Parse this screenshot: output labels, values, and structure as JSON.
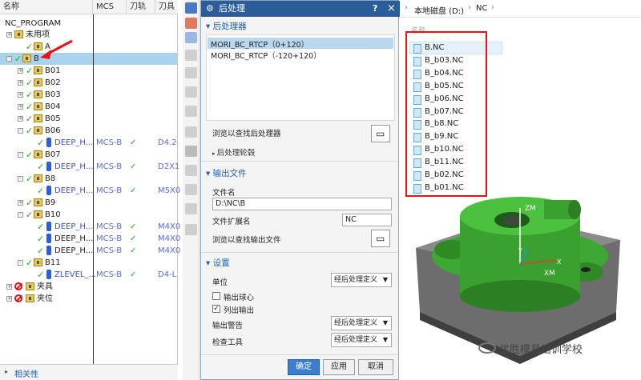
{
  "navigator": {
    "columns": [
      "名称",
      "MCS",
      "刀轨",
      "刀具"
    ],
    "root": "NC_PROGRAM",
    "rows": [
      {
        "indent": 0,
        "exp": "+",
        "icon": "none",
        "label": "未用项",
        "mcs": "",
        "path": "",
        "tool": ""
      },
      {
        "indent": 1,
        "exp": "",
        "icon": "group",
        "label": "A",
        "mcs": "",
        "path": "",
        "tool": ""
      },
      {
        "indent": 0,
        "exp": "-",
        "icon": "group",
        "label": "B",
        "mcs": "",
        "path": "",
        "tool": "",
        "selected": true
      },
      {
        "indent": 1,
        "exp": "+",
        "icon": "group",
        "label": "B01",
        "mcs": "",
        "path": "",
        "tool": ""
      },
      {
        "indent": 1,
        "exp": "+",
        "icon": "group",
        "label": "B02",
        "mcs": "",
        "path": "",
        "tool": ""
      },
      {
        "indent": 1,
        "exp": "+",
        "icon": "group",
        "label": "B03",
        "mcs": "",
        "path": "",
        "tool": ""
      },
      {
        "indent": 1,
        "exp": "+",
        "icon": "group",
        "label": "B04",
        "mcs": "",
        "path": "",
        "tool": ""
      },
      {
        "indent": 1,
        "exp": "+",
        "icon": "group",
        "label": "B05",
        "mcs": "",
        "path": "",
        "tool": ""
      },
      {
        "indent": 1,
        "exp": "-",
        "icon": "group",
        "label": "B06",
        "mcs": "",
        "path": "",
        "tool": ""
      },
      {
        "indent": 2,
        "exp": "",
        "icon": "op",
        "label": "DEEP_H...",
        "mcs": "MCS-B",
        "path": "✓",
        "tool": "D4.2",
        "op": true
      },
      {
        "indent": 1,
        "exp": "-",
        "icon": "group",
        "label": "B07",
        "mcs": "",
        "path": "",
        "tool": ""
      },
      {
        "indent": 2,
        "exp": "",
        "icon": "op",
        "label": "DEEP_H...",
        "mcs": "MCS-B",
        "path": "✓",
        "tool": "D2X1",
        "op": true
      },
      {
        "indent": 1,
        "exp": "-",
        "icon": "group",
        "label": "B8",
        "mcs": "",
        "path": "",
        "tool": ""
      },
      {
        "indent": 2,
        "exp": "",
        "icon": "op",
        "label": "DEEP_H...",
        "mcs": "MCS-B",
        "path": "✓",
        "tool": "M5X0",
        "op": true
      },
      {
        "indent": 1,
        "exp": "+",
        "icon": "group",
        "label": "B9",
        "mcs": "",
        "path": "",
        "tool": ""
      },
      {
        "indent": 1,
        "exp": "-",
        "icon": "group",
        "label": "B10",
        "mcs": "",
        "path": "",
        "tool": ""
      },
      {
        "indent": 2,
        "exp": "",
        "icon": "op",
        "label": "DEEP_H...",
        "mcs": "MCS-B",
        "path": "✓",
        "tool": "M4X0",
        "op": true
      },
      {
        "indent": 2,
        "exp": "",
        "icon": "op",
        "label": "DEEP_H...",
        "mcs": "MCS-B",
        "path": "✓",
        "tool": "M4X0",
        "op": false
      },
      {
        "indent": 2,
        "exp": "",
        "icon": "op",
        "label": "DEEP_H...",
        "mcs": "MCS-B",
        "path": "✓",
        "tool": "M4X0",
        "op": false
      },
      {
        "indent": 1,
        "exp": "-",
        "icon": "group",
        "label": "B11",
        "mcs": "",
        "path": "",
        "tool": ""
      },
      {
        "indent": 2,
        "exp": "",
        "icon": "op",
        "label": "ZLEVEL_...",
        "mcs": "MCS-B",
        "path": "✓",
        "tool": "D4-L",
        "op": true
      },
      {
        "indent": 0,
        "exp": "+",
        "icon": "noop",
        "label": "夹具",
        "mcs": "",
        "path": "",
        "tool": ""
      },
      {
        "indent": 0,
        "exp": "+",
        "icon": "noop",
        "label": "夹位",
        "mcs": "",
        "path": "",
        "tool": ""
      }
    ],
    "bottom": "相关性"
  },
  "dialog": {
    "title": "后处理",
    "help": "?",
    "close": "×",
    "sec_post": "后处理器",
    "post_items": [
      "MORI_BC_RTCP（0+120）",
      "MORI_BC_RTCP（-120+120）"
    ],
    "browse_post": "浏览以查找后处理器",
    "post_wizard": "后处理轮毂",
    "sec_output": "输出文件",
    "file_name_label": "文件名",
    "file_name_value": "D:\\NC\\B",
    "ext_label": "文件扩展名",
    "ext_value": "NC",
    "browse_out": "浏览以查找输出文件",
    "sec_settings": "设置",
    "unit_label": "单位",
    "unit_value": "经后处理定义",
    "opt_center": "输出球心",
    "opt_list": "列出输出",
    "warn_label": "输出警告",
    "warn_value": "经后处理定义",
    "check_label": "检查工具",
    "check_value": "经后处理定义",
    "ok": "确定",
    "apply": "应用",
    "cancel": "取消"
  },
  "explorer": {
    "crumbs": [
      "本地磁盘 (D:)",
      "NC"
    ],
    "column_name": "名称",
    "files": [
      "B.NC",
      "B_b03.NC",
      "B_b04.NC",
      "B_b05.NC",
      "B_b06.NC",
      "B_b07.NC",
      "B_b8.NC",
      "B_b9.NC",
      "B_b10.NC",
      "B_b11.NC",
      "B_b02.NC",
      "B_b01.NC"
    ],
    "watermark": "优胜模具培训学校",
    "axes": {
      "zm": "ZM",
      "xm": "XM",
      "y": "Y",
      "x": "X"
    }
  }
}
